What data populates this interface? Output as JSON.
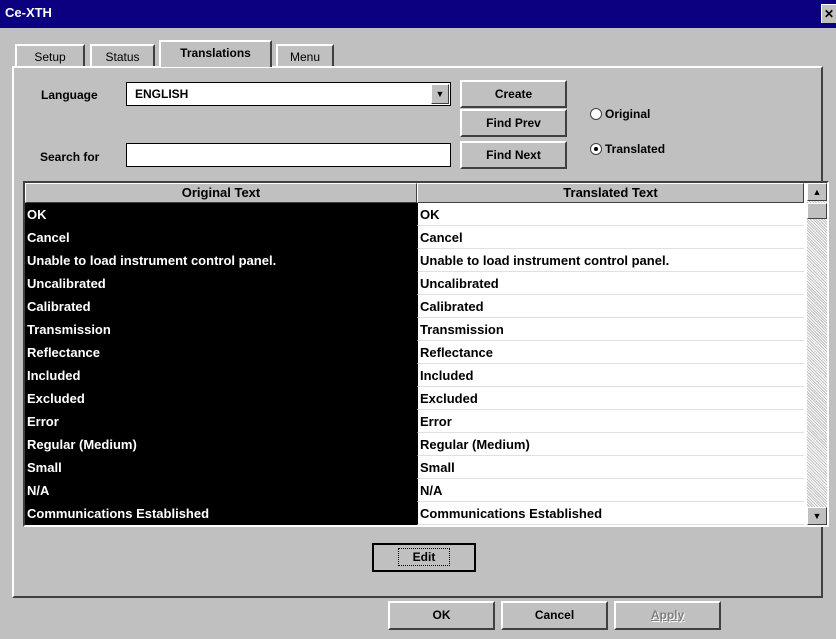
{
  "window": {
    "title": "Ce-XTH",
    "close_glyph": "✕"
  },
  "tabs": [
    {
      "label": "Setup"
    },
    {
      "label": "Status"
    },
    {
      "label": "Translations"
    },
    {
      "label": "Menu"
    }
  ],
  "form": {
    "language_label": "Language",
    "language_value": "ENGLISH",
    "search_label": "Search for",
    "search_value": ""
  },
  "buttons": {
    "create": "Create",
    "find_prev": "Find Prev",
    "find_next": "Find Next",
    "edit": "Edit",
    "ok": "OK",
    "cancel": "Cancel",
    "apply": "Apply"
  },
  "radios": {
    "original": "Original",
    "translated": "Translated",
    "selected": "translated"
  },
  "table": {
    "headers": [
      "Original Text",
      "Translated Text"
    ],
    "rows": [
      {
        "original": "OK",
        "translated": "OK"
      },
      {
        "original": "Cancel",
        "translated": "Cancel"
      },
      {
        "original": "Unable to load instrument control panel.",
        "translated": "Unable to load instrument control panel."
      },
      {
        "original": "Uncalibrated",
        "translated": "Uncalibrated"
      },
      {
        "original": "Calibrated",
        "translated": "Calibrated"
      },
      {
        "original": "Transmission",
        "translated": "Transmission"
      },
      {
        "original": "Reflectance",
        "translated": "Reflectance"
      },
      {
        "original": "Included",
        "translated": "Included"
      },
      {
        "original": "Excluded",
        "translated": "Excluded"
      },
      {
        "original": "Error",
        "translated": "Error"
      },
      {
        "original": "Regular (Medium)",
        "translated": "Regular (Medium)"
      },
      {
        "original": "Small",
        "translated": "Small"
      },
      {
        "original": "N/A",
        "translated": "N/A"
      },
      {
        "original": "Communications Established",
        "translated": "Communications Established"
      }
    ]
  },
  "colors": {
    "title_bar": "#0a0080",
    "face": "#c0c0c0",
    "selected_cell": "#000000"
  }
}
